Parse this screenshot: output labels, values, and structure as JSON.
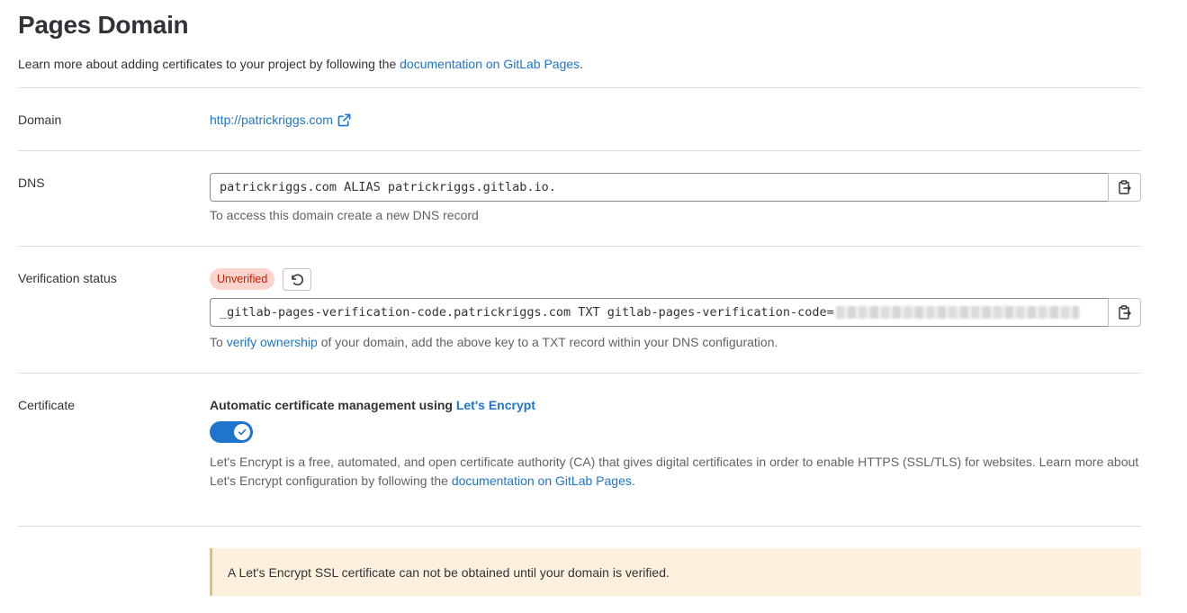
{
  "page": {
    "title": "Pages Domain",
    "intro_text": "Learn more about adding certificates to your project by following the ",
    "intro_link": "documentation on GitLab Pages",
    "intro_end": "."
  },
  "domain": {
    "label": "Domain",
    "url": "http://patrickriggs.com",
    "icon": "external-link-icon"
  },
  "dns": {
    "label": "DNS",
    "record": "patrickriggs.com ALIAS patrickriggs.gitlab.io.",
    "help": "To access this domain create a new DNS record",
    "copy_icon": "copy-to-clipboard-icon"
  },
  "verification": {
    "label": "Verification status",
    "status": "Unverified",
    "retry_icon": "retry-icon",
    "record": "_gitlab-pages-verification-code.patrickriggs.com TXT gitlab-pages-verification-code=",
    "help_prefix": "To ",
    "help_link": "verify ownership",
    "help_suffix": " of your domain, add the above key to a TXT record within your DNS configuration.",
    "copy_icon": "copy-to-clipboard-icon"
  },
  "certificate": {
    "label": "Certificate",
    "heading": "Automatic certificate management using ",
    "heading_link": "Let's Encrypt",
    "toggle_on": true,
    "desc_text": "Let's Encrypt is a free, automated, and open certificate authority (CA) that gives digital certificates in order to enable HTTPS (SSL/TLS) for websites. Learn more about Let's Encrypt configuration by following the ",
    "desc_link": "documentation on GitLab Pages",
    "desc_end": "."
  },
  "alert": {
    "text": "A Let's Encrypt SSL certificate can not be obtained until your domain is verified."
  },
  "colors": {
    "link": "#1f75cb",
    "badge_bg": "#fdd4cd",
    "badge_text": "#c91c00",
    "toggle": "#1f75cb",
    "alert_bg": "#fdf1dd"
  }
}
